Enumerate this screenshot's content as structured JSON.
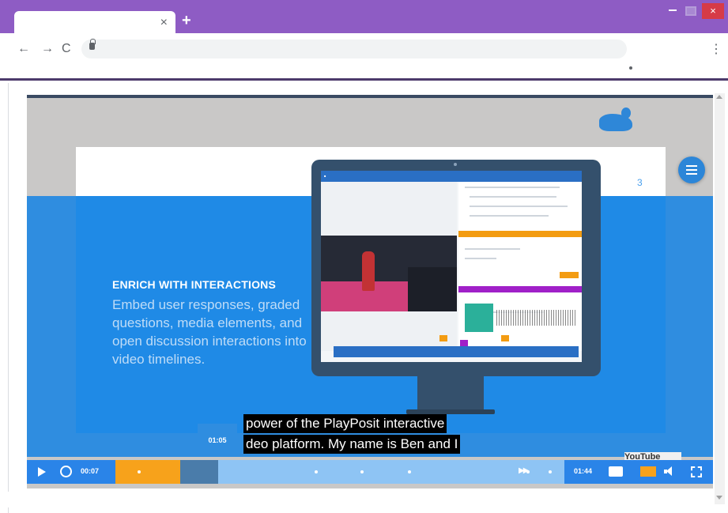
{
  "browser": {
    "tab_close": "×",
    "new_tab": "+",
    "window_close": "×",
    "nav_back": "←",
    "nav_forward": "→",
    "nav_reload": "C",
    "menu": "⋮"
  },
  "video": {
    "slide": {
      "headline": "ENRICH WITH INTERACTIONS",
      "body": "Embed user responses, graded questions, media elements, and open discussion interactions into video timelines.",
      "corner_mark": "3"
    },
    "captions": {
      "line1": "power of the PlayPosit interactive",
      "line2": "deo platform. My name is Ben and I"
    },
    "time_bubble": "01:05",
    "youtube_label": "YouTube"
  },
  "player": {
    "current_time": "00:07",
    "duration": "01:44",
    "progress_fraction": 0.145,
    "buffer_fraction": 0.085,
    "accent": "#2a84e8",
    "played_color": "#f7a21b"
  },
  "icons": {
    "play": "play-icon",
    "rewind": "rewind-icon",
    "fast_forward": "fast-forward-icon",
    "captions": "closed-captions-icon",
    "volume": "volume-icon",
    "fullscreen": "fullscreen-icon",
    "menu": "hamburger-menu-icon"
  }
}
